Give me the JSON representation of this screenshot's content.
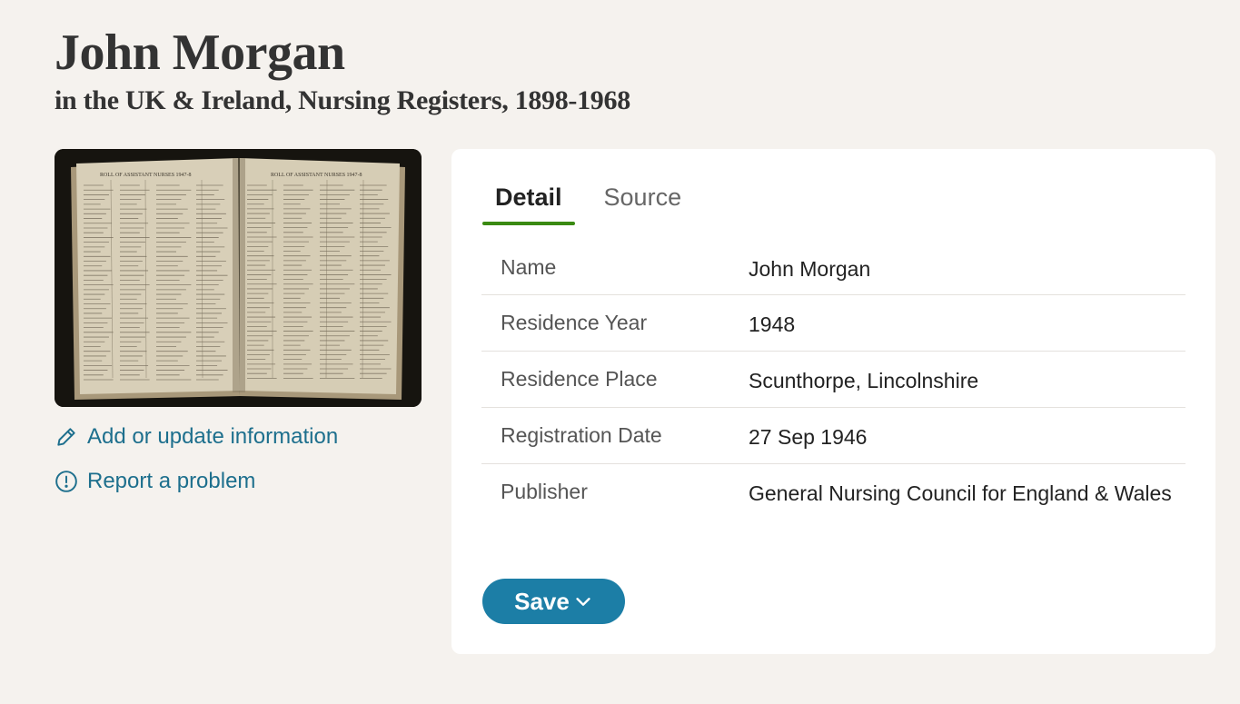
{
  "record": {
    "name": "John Morgan",
    "collection": "in the UK & Ireland, Nursing Registers, 1898-1968"
  },
  "image": {
    "left_header": "ROLL OF ASSISTANT NURSES 1947-8",
    "right_header": "ROLL OF ASSISTANT NURSES 1947-8"
  },
  "actions": {
    "add_update": "Add or update information",
    "report": "Report a problem"
  },
  "tabs": [
    {
      "label": "Detail",
      "active": true
    },
    {
      "label": "Source",
      "active": false
    }
  ],
  "details": [
    {
      "label": "Name",
      "value": "John Morgan"
    },
    {
      "label": "Residence Year",
      "value": "1948"
    },
    {
      "label": "Residence Place",
      "value": "Scunthorpe, Lincolnshire"
    },
    {
      "label": "Registration Date",
      "value": "27 Sep 1946"
    },
    {
      "label": "Publisher",
      "value": "General Nursing Council for England & Wales"
    }
  ],
  "save_button": {
    "label": "Save"
  },
  "colors": {
    "background": "#f5f2ee",
    "link": "#1d6f8d",
    "tab_underline": "#3a8a12",
    "save_button": "#1c7ea6"
  },
  "icons": [
    "pencil-icon",
    "alert-circle-icon",
    "chevron-down-icon"
  ]
}
